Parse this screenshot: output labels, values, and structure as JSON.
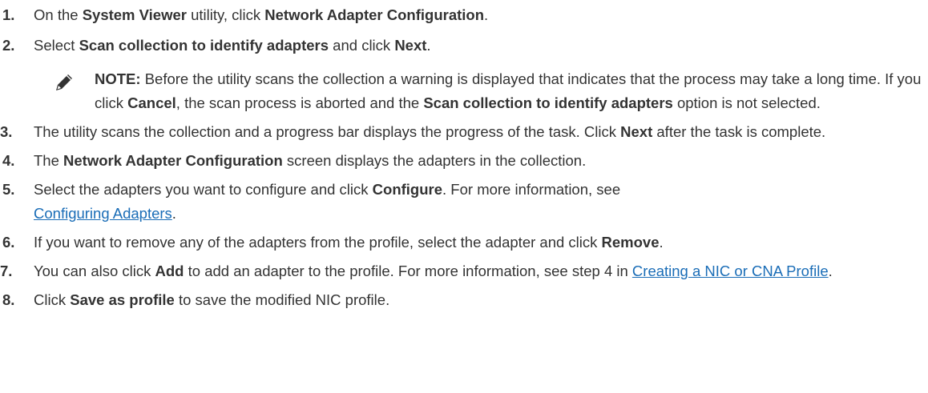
{
  "steps": [
    {
      "num": "1.",
      "t1": "On the ",
      "b1": "System Viewer",
      "t2": " utility, click ",
      "b2": "Network Adapter Configuration",
      "t3": "."
    },
    {
      "num": "2.",
      "t1": "Select ",
      "b1": "Scan collection to identify adapters",
      "t2": " and click ",
      "b2": "Next",
      "t3": "."
    },
    {
      "num": "3.",
      "t1": "The utility scans the collection and a progress bar displays the progress of the task. Click ",
      "b1": "Next",
      "t2": " after the task is complete."
    },
    {
      "num": "4.",
      "t1": "The ",
      "b1": "Network Adapter Configuration",
      "t2": " screen displays the adapters in the collection."
    },
    {
      "num": "5.",
      "t1": "Select the adapters you want to configure and click ",
      "b1": "Configure",
      "t2": ". For more information, see ",
      "link": "Configuring Adapters",
      "t3": "."
    },
    {
      "num": "6.",
      "t1": "If you want to remove any of the adapters from the profile, select the adapter and click ",
      "b1": "Remove",
      "t2": "."
    },
    {
      "num": "7.",
      "t1": "You can also click ",
      "b1": "Add",
      "t2": " to add an adapter to the profile. For more information, see step 4 in ",
      "link": "Creating a NIC or CNA Profile",
      "t3": "."
    },
    {
      "num": "8.",
      "t1": "Click ",
      "b1": "Save as profile",
      "t2": " to save the modified NIC profile."
    }
  ],
  "note": {
    "icon": "pencil-icon",
    "label": "NOTE:",
    "t1": " Before the utility scans the collection a warning is displayed that indicates that the process may take a long time. If you click ",
    "b1": "Cancel",
    "t2": ", the scan process is aborted and the ",
    "b2": "Scan collection to identify adapters",
    "t3": " option is not selected."
  },
  "colors": {
    "text": "#333333",
    "link": "#1a6db7"
  }
}
